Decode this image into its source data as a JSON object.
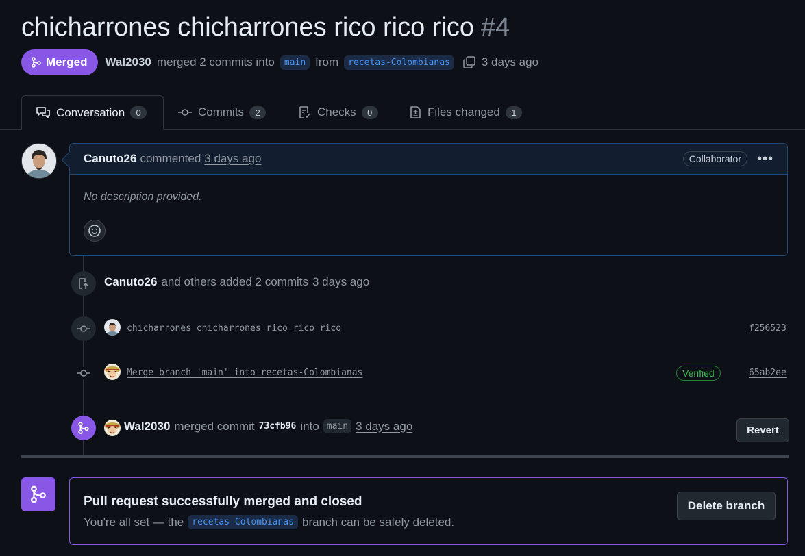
{
  "pr": {
    "title": "chicharrones chicharrones rico rico rico",
    "number": "#4"
  },
  "meta": {
    "state": "Merged",
    "author": "Wal2030",
    "action": "merged 2 commits into",
    "base_branch": "main",
    "from_label": "from",
    "head_branch": "recetas-Colombianas",
    "time": "3 days ago"
  },
  "tabs": [
    {
      "label": "Conversation",
      "count": "0"
    },
    {
      "label": "Commits",
      "count": "2"
    },
    {
      "label": "Checks",
      "count": "0"
    },
    {
      "label": "Files changed",
      "count": "1"
    }
  ],
  "comment": {
    "author": "Canuto26",
    "verb": "commented",
    "time": "3 days ago",
    "role": "Collaborator",
    "body": "No description provided."
  },
  "timeline": {
    "added": {
      "user": "Canuto26",
      "text": "and others added 2 commits",
      "time": "3 days ago"
    },
    "commits": [
      {
        "message": "chicharrones chicharrones rico rico rico",
        "sha": "f256523"
      },
      {
        "message": "Merge branch 'main' into recetas-Colombianas",
        "badge": "Verified",
        "sha": "65ab2ee"
      }
    ],
    "merged": {
      "user": "Wal2030",
      "text": "merged commit",
      "commit": "73cfb96",
      "into": "into",
      "branch": "main",
      "time": "3 days ago",
      "revert_label": "Revert"
    }
  },
  "merged_box": {
    "title": "Pull request successfully merged and closed",
    "text_before": "You're all set — the",
    "branch": "recetas-Colombianas",
    "text_after": "branch can be safely deleted.",
    "delete_label": "Delete branch"
  },
  "colors": {
    "merged": "#8957e5",
    "link": "#4493f8",
    "verified": "#3fb950",
    "background": "#0d1117"
  }
}
